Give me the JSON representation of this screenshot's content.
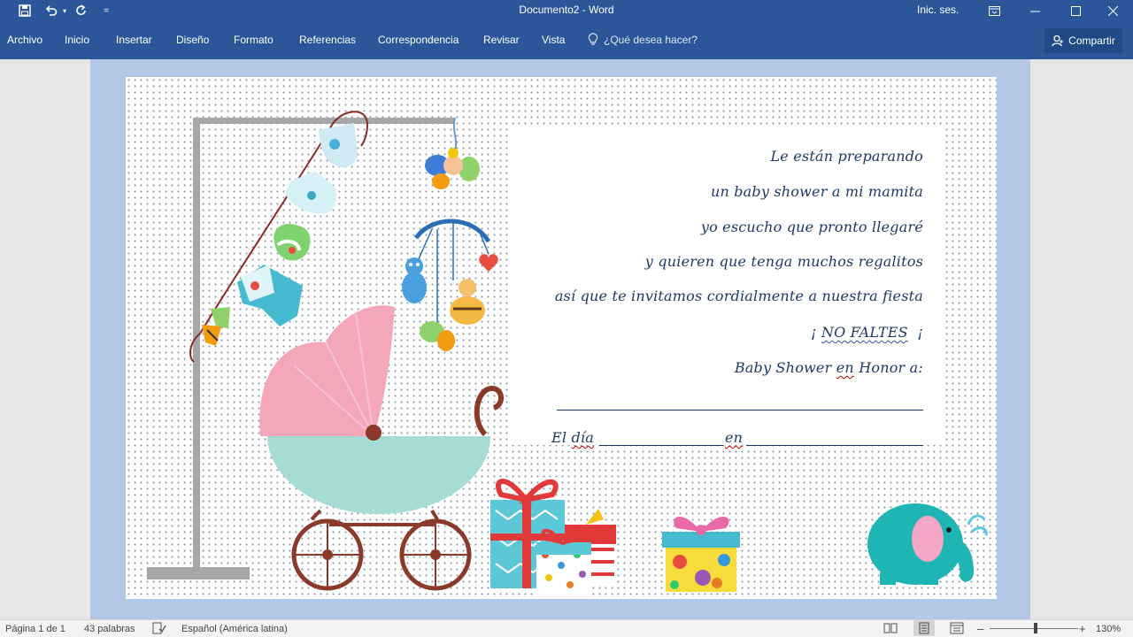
{
  "titlebar": {
    "title": "Documento2  -  Word",
    "signin": "Inic. ses.",
    "undo_arrow": "▾",
    "qat_more": "="
  },
  "ribbon": {
    "tabs": [
      "Archivo",
      "Inicio",
      "Insertar",
      "Diseño",
      "Formato",
      "Referencias",
      "Correspondencia",
      "Revisar",
      "Vista"
    ],
    "tellme": "¿Qué desea hacer?",
    "share": "Compartir"
  },
  "invitation": {
    "line1": "Le están preparando",
    "line2": "un baby shower a mi mamita",
    "line3": "yo escucho que pronto llegaré",
    "line4": "y quieren que tenga muchos regalitos",
    "line5": "así que te invitamos cordialmente a nuestra fiesta",
    "excl_open": "¡",
    "no_faltes": "NO FALTES",
    "excl_close": "¡",
    "honor_a": "Baby Shower ",
    "honor_en": "en",
    "honor_b": " Honor a:",
    "el": "El ",
    "dia": "día",
    "en": "en"
  },
  "status": {
    "page": "Página 1 de 1",
    "words": "43 palabras",
    "language": "Español (América latina)",
    "zoom_minus": "–",
    "zoom_plus": "+",
    "zoom": "130%",
    "zoom_level": 0.52
  }
}
